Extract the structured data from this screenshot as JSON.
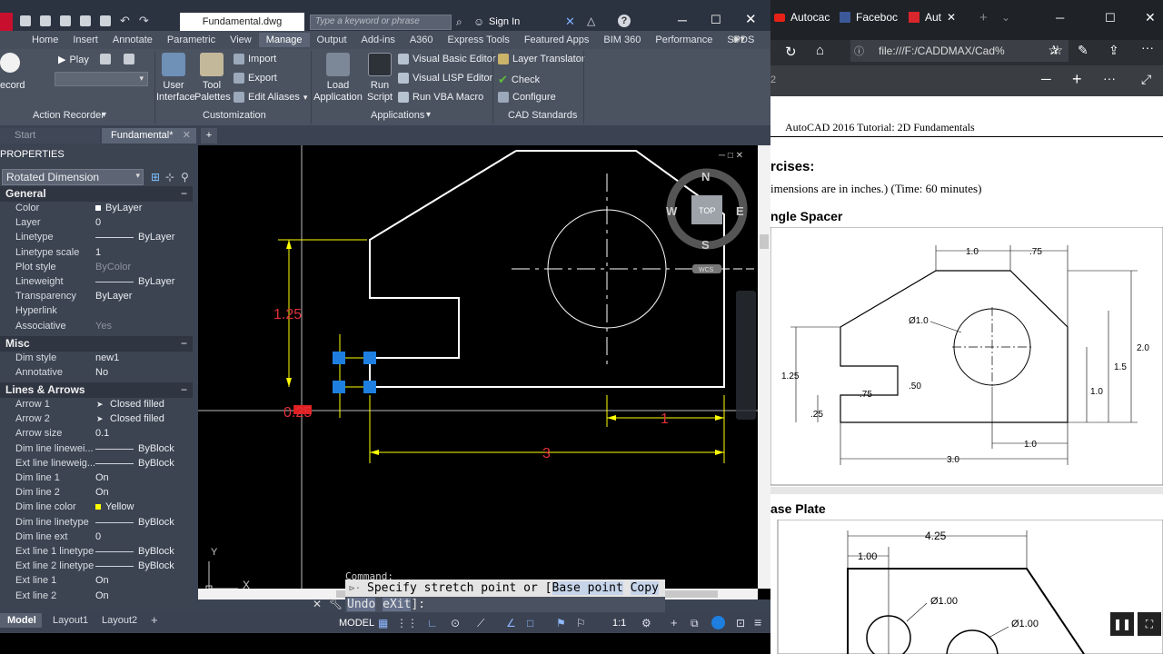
{
  "titlebar": {
    "filename": "Fundamental.dwg",
    "search_placeholder": "Type a keyword or phrase",
    "sign_in": "Sign In"
  },
  "ribbon": {
    "tabs": [
      "Home",
      "Insert",
      "Annotate",
      "Parametric",
      "View",
      "Manage",
      "Output",
      "Add-ins",
      "A360",
      "Express Tools",
      "Featured Apps",
      "BIM 360",
      "Performance",
      "SPDS"
    ],
    "active_tab": "Manage",
    "action_recorder": {
      "play": "Play",
      "record": "ecord",
      "title": "Action Recorder"
    },
    "customization": {
      "user_interface": [
        "User",
        "Interface"
      ],
      "tool_palettes": [
        "Tool",
        "Palettes"
      ],
      "import": "Import",
      "export": "Export",
      "edit_aliases": "Edit Aliases",
      "title": "Customization"
    },
    "applications": {
      "load_application": [
        "Load",
        "Application"
      ],
      "run_script": [
        "Run",
        "Script"
      ],
      "vbe": "Visual Basic Editor",
      "vlisp": "Visual LISP Editor",
      "vba": "Run VBA Macro",
      "title": "Applications"
    },
    "cad_standards": {
      "layer_translator": "Layer Translator",
      "check": "Check",
      "configure": "Configure",
      "title": "CAD Standards"
    }
  },
  "file_tabs": {
    "start": "Start",
    "current": "Fundamental*"
  },
  "properties": {
    "header": "PROPERTIES",
    "selection": "Rotated Dimension",
    "general_title": "General",
    "general": [
      {
        "label": "Color",
        "value": "ByLayer"
      },
      {
        "label": "Layer",
        "value": "0"
      },
      {
        "label": "Linetype",
        "value": "ByLayer"
      },
      {
        "label": "Linetype scale",
        "value": "1"
      },
      {
        "label": "Plot style",
        "value": "ByColor"
      },
      {
        "label": "Lineweight",
        "value": "ByLayer"
      },
      {
        "label": "Transparency",
        "value": "ByLayer"
      },
      {
        "label": "Hyperlink",
        "value": ""
      },
      {
        "label": "Associative",
        "value": "Yes"
      }
    ],
    "misc_title": "Misc",
    "misc": [
      {
        "label": "Dim style",
        "value": "new1"
      },
      {
        "label": "Annotative",
        "value": "No"
      }
    ],
    "lines_title": "Lines & Arrows",
    "lines": [
      {
        "label": "Arrow 1",
        "value": "Closed filled"
      },
      {
        "label": "Arrow 2",
        "value": "Closed filled"
      },
      {
        "label": "Arrow size",
        "value": "0.1"
      },
      {
        "label": "Dim line linewei...",
        "value": "ByBlock"
      },
      {
        "label": "Ext line lineweig...",
        "value": "ByBlock"
      },
      {
        "label": "Dim line 1",
        "value": "On"
      },
      {
        "label": "Dim line 2",
        "value": "On"
      },
      {
        "label": "Dim line color",
        "value": "Yellow"
      },
      {
        "label": "Dim line linetype",
        "value": "ByBlock"
      },
      {
        "label": "Dim line ext",
        "value": "0"
      },
      {
        "label": "Ext line 1 linetype",
        "value": "ByBlock"
      },
      {
        "label": "Ext line 2 linetype",
        "value": "ByBlock"
      },
      {
        "label": "Ext line 1",
        "value": "On"
      },
      {
        "label": "Ext line 2",
        "value": "On"
      }
    ]
  },
  "drawing": {
    "dim_125": "1.25",
    "dim_1": "1",
    "dim_3": "3",
    "dim_025": "0.25",
    "viewcube": {
      "n": "N",
      "s": "S",
      "e": "E",
      "w": "W",
      "top": "TOP",
      "wcs": "WCS"
    },
    "ucs_x": "X",
    "ucs_y": "Y"
  },
  "command": {
    "label": "Command:",
    "prompt": "Specify stretch point or [",
    "opt1": "Base point",
    "opt2": "Copy",
    "opt3": "Undo",
    "opt4": "eXit",
    "end": "]:"
  },
  "layout_tabs": [
    "Model",
    "Layout1",
    "Layout2"
  ],
  "statusbar": {
    "model": "MODEL",
    "scale": "1:1"
  },
  "browser": {
    "tabs": [
      "Autocac",
      "Faceboc",
      "Aut"
    ],
    "url": "file:///F:/CADDMAX/Cad%",
    "page_num": "2",
    "doc": {
      "header": "AutoCAD 2016 Tutorial: 2D Fundamentals",
      "section": "rcises:",
      "note": "imensions are in inches.) (Time: 60 minutes)",
      "ex1": "ngle Spacer",
      "ex2": "ase Plate",
      "dims1": [
        "1.0",
        ".75",
        "Ø1.0",
        "2.0",
        "1.25",
        "1.5",
        ".75",
        ".50",
        "1.0",
        ".25",
        "1.0",
        "3.0"
      ],
      "dims2": [
        "4.25",
        "1.00",
        "Ø1.00",
        "Ø1.00"
      ]
    }
  }
}
